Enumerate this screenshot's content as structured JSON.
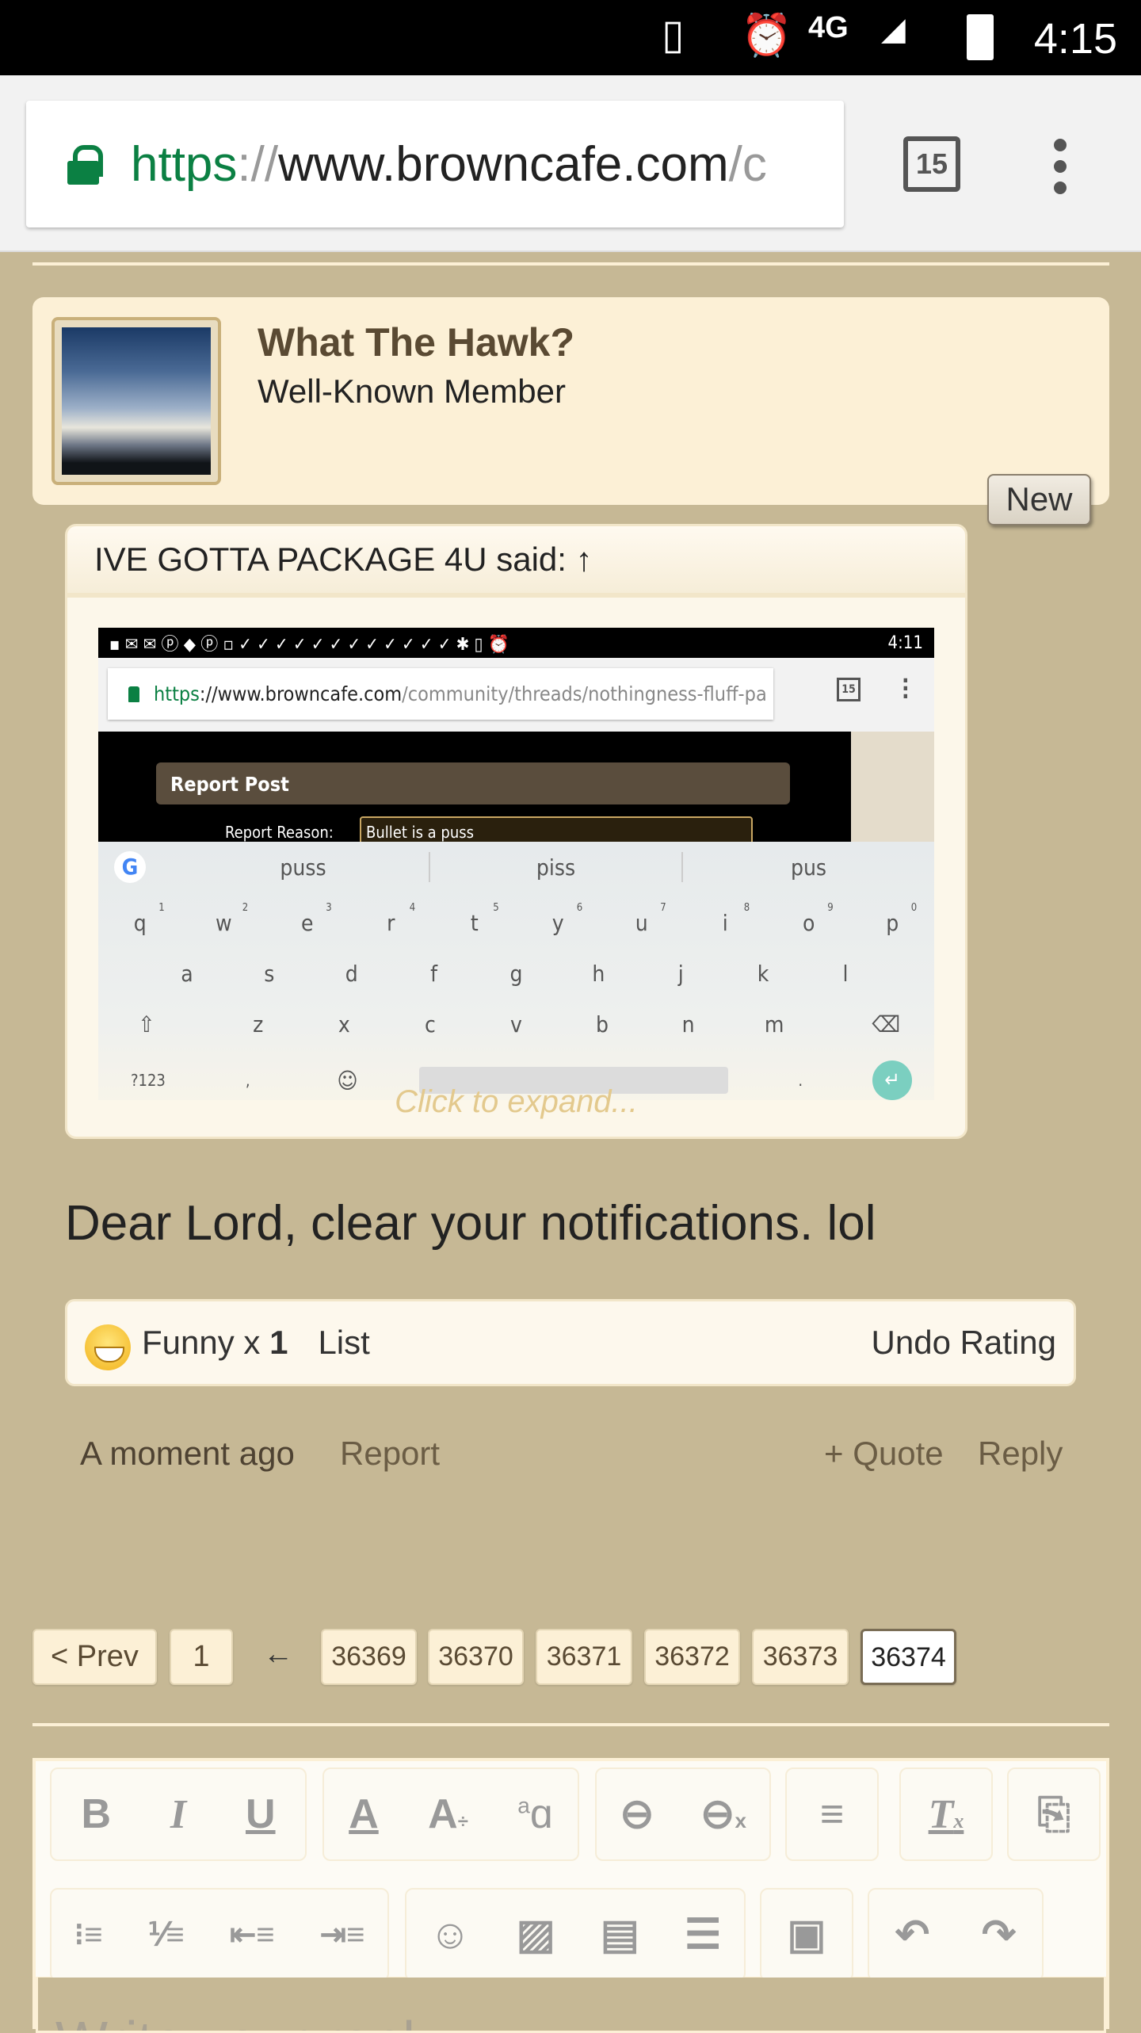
{
  "status_bar": {
    "time": "4:15",
    "icons": [
      "vibrate-icon",
      "alarm-icon",
      "4g-lte-icon",
      "signal-icon",
      "battery-icon"
    ]
  },
  "browser": {
    "url_scheme": "https",
    "url_sep": "://",
    "url_domain": "www.browncafe.com",
    "url_path": "/c",
    "tab_count": "15"
  },
  "post_author": {
    "name": "What The Hawk?",
    "title": "Well-Known Member",
    "badge": "New"
  },
  "quote": {
    "header": "IVE GOTTA PACKAGE 4U said: ↑",
    "expand": "Click to expand...",
    "screenshot": {
      "time": "4:11",
      "url_scheme": "https",
      "url_domain": "://www.browncafe.com",
      "url_path": "/community/threads/nothingness-fluff-pa",
      "tab_count": "15",
      "dialog_title": "Report Post",
      "reason_label": "Report Reason:",
      "reason_value": "Bullet is a puss",
      "suggestions": [
        "puss",
        "piss",
        "pus"
      ],
      "row1": [
        "q",
        "w",
        "e",
        "r",
        "t",
        "y",
        "u",
        "i",
        "o",
        "p"
      ],
      "row1_nums": [
        "1",
        "2",
        "3",
        "4",
        "5",
        "6",
        "7",
        "8",
        "9",
        "0"
      ],
      "row2": [
        "a",
        "s",
        "d",
        "f",
        "g",
        "h",
        "j",
        "k",
        "l"
      ],
      "row3": [
        "z",
        "x",
        "c",
        "v",
        "b",
        "n",
        "m"
      ],
      "symbols_key": "?123",
      "comma": ",",
      "period": "."
    }
  },
  "message": "Dear Lord, clear your notifications. lol",
  "rating": {
    "label": "Funny x ",
    "count": "1",
    "list": "List",
    "undo": "Undo Rating"
  },
  "footer": {
    "time": "A moment ago",
    "report": "Report",
    "quote": "+ Quote",
    "reply": "Reply"
  },
  "pagination": {
    "prev": "< Prev",
    "first": "1",
    "ellipsis": "←",
    "pages": [
      "36369",
      "36370",
      "36371",
      "36372",
      "36373",
      "36374"
    ],
    "current": "36374"
  },
  "editor": {
    "placeholder": "Write your reply..."
  },
  "colors": {
    "page_bg": "#c6b895",
    "card_bg": "#fcf0d6",
    "url_green": "#0b8043",
    "author": "#5a4a33"
  }
}
